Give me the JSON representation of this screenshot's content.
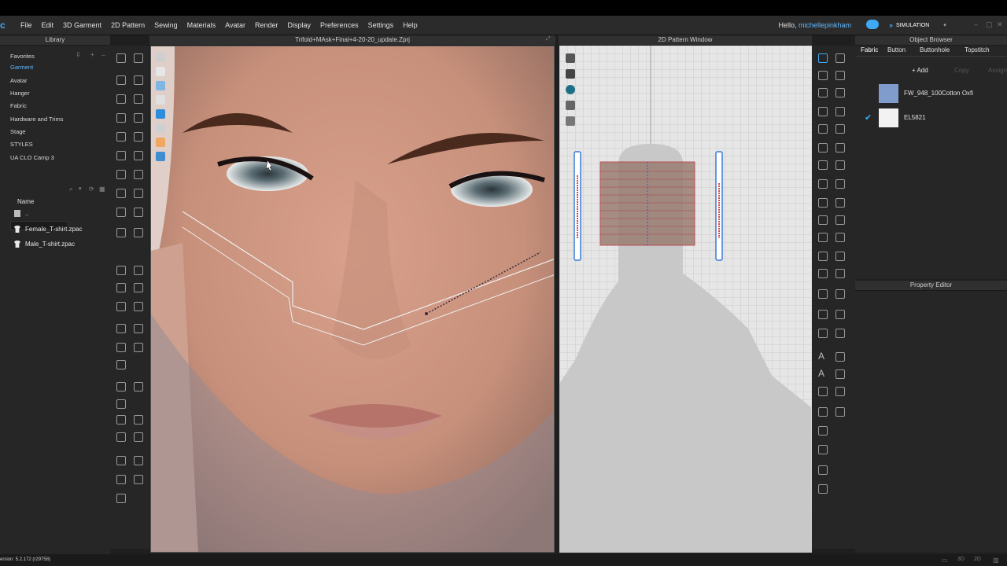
{
  "menubar": {
    "items": [
      "File",
      "Edit",
      "3D Garment",
      "2D Pattern",
      "Sewing",
      "Materials",
      "Avatar",
      "Render",
      "Display",
      "Preferences",
      "Settings",
      "Help"
    ],
    "hello": "Hello, ",
    "user": "michellepinkham",
    "simulation": "SIMULATION"
  },
  "library": {
    "title": "Library",
    "items": [
      "Favorites",
      "Garment",
      "Avatar",
      "Hanger",
      "Fabric",
      "Hardware and Trims",
      "Stage",
      "STYLES",
      "UA CLO Camp 3"
    ],
    "active_index": 1,
    "name_header": "Name",
    "files": [
      "..",
      "Female_T-shirt.zpac",
      "Male_T-shirt.zpac"
    ]
  },
  "view3d": {
    "title": "Trifold+MAsk+Final+4-20-20_update.Zprj"
  },
  "pattern": {
    "title": "2D Pattern Window"
  },
  "object_browser": {
    "title": "Object Browser",
    "tabs": [
      "Fabric",
      "Button",
      "Buttonhole",
      "Topstitch"
    ],
    "add_label": "+ Add",
    "copy_label": "Copy",
    "assign_label": "Assign",
    "fabrics": [
      {
        "name": "FW_948_100Cotton Oxfi",
        "color": "#7f9ccc",
        "checked": false
      },
      {
        "name": "EL5821",
        "color": "#f2f2f2",
        "checked": true
      }
    ]
  },
  "property_editor": {
    "title": "Property Editor"
  },
  "status": {
    "version": "ersion: 5.2.172 (r29758)"
  },
  "colors": {
    "accent": "#3fa9f5",
    "panel": "#262626"
  }
}
